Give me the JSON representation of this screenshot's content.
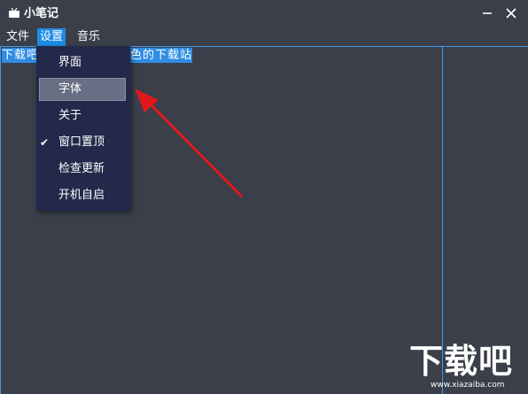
{
  "window": {
    "title": "小笔记"
  },
  "menubar": {
    "items": [
      {
        "label": "文件"
      },
      {
        "label": "设置"
      },
      {
        "label": "音乐"
      }
    ]
  },
  "editor": {
    "text_left": "下载吧",
    "text_right": "色的下载站"
  },
  "dropdown": {
    "items": [
      {
        "label": "界面",
        "checked": false
      },
      {
        "label": "字体",
        "checked": false
      },
      {
        "label": "关于",
        "checked": false
      },
      {
        "label": "窗口置顶",
        "checked": true,
        "check_glyph": "✔"
      },
      {
        "label": "检查更新",
        "checked": false
      },
      {
        "label": "开机自启",
        "checked": false
      }
    ]
  },
  "watermark": {
    "main": "下载吧",
    "url": "www.xiazaiba.com"
  },
  "colors": {
    "background": "#3a3f4a",
    "accent": "#1e8ce6",
    "menu_bg": "#22294a",
    "arrow": "#e0181b"
  }
}
